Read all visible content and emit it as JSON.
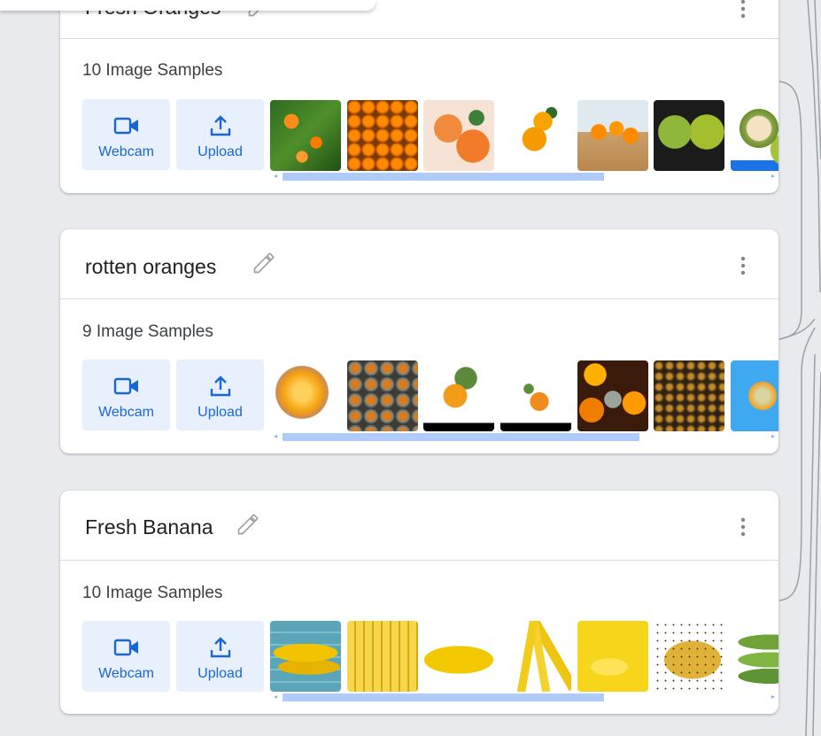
{
  "classes": [
    {
      "title": "Fresh Oranges",
      "samples_label": "10 Image Samples",
      "webcam_label": "Webcam",
      "upload_label": "Upload",
      "thumbnails": [
        "orange-tree-photo",
        "oranges-grid-photo",
        "tangerines-photo",
        "orange-branch-photo",
        "orange-basket-photo",
        "green-oranges-photo",
        "cut-orange-photo"
      ],
      "scroll_fraction": 0.64
    },
    {
      "title": "rotten oranges",
      "samples_label": "9 Image Samples",
      "webcam_label": "Webcam",
      "upload_label": "Upload",
      "thumbnails": [
        "moldy-orange-photo",
        "rotten-orange-pile-photo",
        "rotten-orange-leaf-photo",
        "rotten-orange-small-photo",
        "rotten-orange-bin-photo",
        "rotten-fruit-pile-photo",
        "moldy-orange-blue-photo"
      ],
      "scroll_fraction": 0.71
    },
    {
      "title": "Fresh Banana",
      "samples_label": "10 Image Samples",
      "webcam_label": "Webcam",
      "upload_label": "Upload",
      "thumbnails": [
        "bananas-wood-photo",
        "banana-bunches-photo",
        "single-banana-photo",
        "banana-cluster-photo",
        "bananas-yellow-bg-photo",
        "spotted-bananas-photo",
        "green-bananas-photo"
      ],
      "scroll_fraction": 0.64
    }
  ],
  "icons": {
    "webcam": "videocam-icon",
    "upload": "upload-icon",
    "edit": "pencil-icon",
    "menu": "more-vert-icon"
  },
  "colors": {
    "accent": "#1967d2",
    "button_bg": "#e8f0fe",
    "scrollbar": "#aecbfa",
    "page_bg": "#e8eaed"
  }
}
